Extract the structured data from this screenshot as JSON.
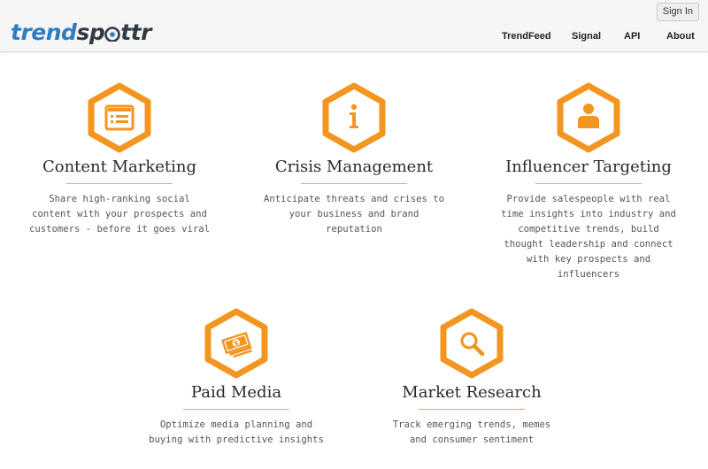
{
  "header": {
    "logo_part1": "trend",
    "logo_part2": "sp",
    "logo_part3": "ttr",
    "signin_label": "Sign In",
    "nav": [
      "TrendFeed",
      "Signal",
      "API",
      "About"
    ]
  },
  "colors": {
    "accent": "#f39621",
    "logo_blue": "#2f7cbf",
    "logo_dark": "#333a44"
  },
  "features": [
    {
      "icon": "list-icon",
      "title": "Content Marketing",
      "description_lines": [
        "Share high-ranking social",
        "content with your prospects and",
        "customers - before it goes viral"
      ]
    },
    {
      "icon": "info-icon",
      "title": "Crisis Management",
      "description_lines": [
        "Anticipate threats and crises to",
        "your business and brand",
        "reputation"
      ]
    },
    {
      "icon": "person-icon",
      "title": "Influencer Targeting",
      "description_lines": [
        "Provide salespeople with real",
        "time insights into industry and",
        "competitive trends, build",
        "thought leadership and connect",
        "with key prospects and",
        "influencers"
      ]
    },
    {
      "icon": "money-icon",
      "title": "Paid Media",
      "description_lines": [
        "Optimize media planning and",
        "buying with predictive insights"
      ]
    },
    {
      "icon": "magnifier-icon",
      "title": "Market Research",
      "description_lines": [
        "Track emerging trends, memes",
        "and consumer sentiment"
      ]
    }
  ]
}
